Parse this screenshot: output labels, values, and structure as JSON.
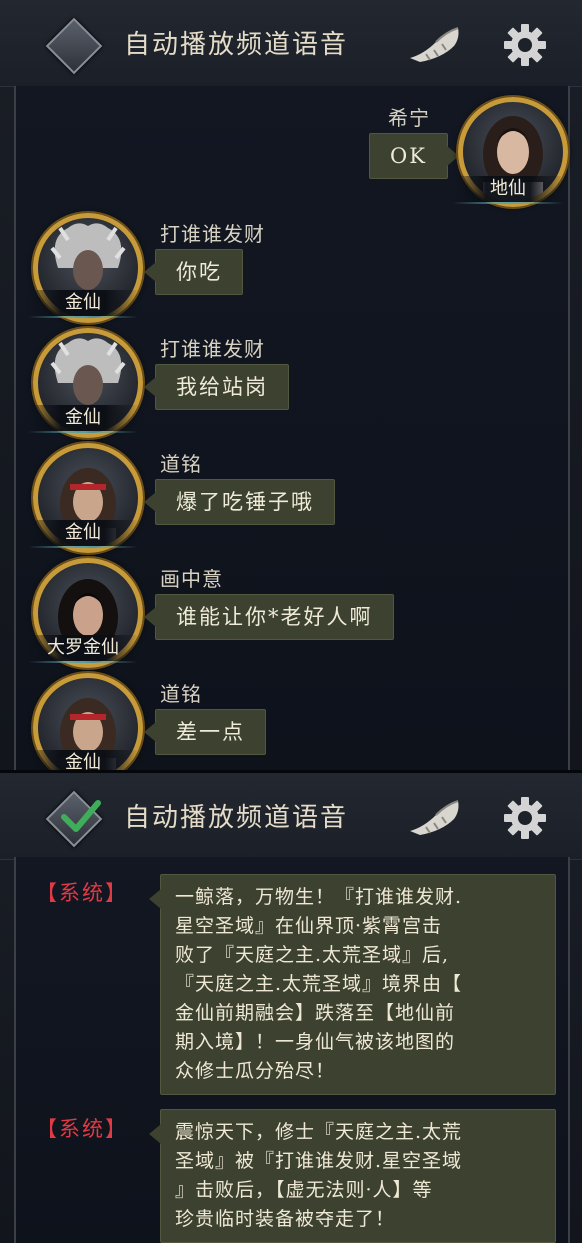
{
  "header": {
    "title": "自动播放频道语音"
  },
  "panel1": {
    "messages": [
      {
        "side": "right",
        "sender": "希宁",
        "rank": "地仙",
        "text": "OK",
        "avatar": "female-portrait"
      },
      {
        "side": "left",
        "sender": "打谁谁发财",
        "rank": "金仙",
        "text": "你吃",
        "avatar": "white-haired-warrior"
      },
      {
        "side": "left",
        "sender": "打谁谁发财",
        "rank": "金仙",
        "text": "我给站岗",
        "avatar": "white-haired-warrior"
      },
      {
        "side": "left",
        "sender": "道铭",
        "rank": "金仙",
        "text": "爆了吃锤子哦",
        "avatar": "headband-warrior"
      },
      {
        "side": "left",
        "sender": "画中意",
        "rank": "大罗金仙",
        "text": "谁能让你*老好人啊",
        "avatar": "dark-haired-woman"
      },
      {
        "side": "left",
        "sender": "道铭",
        "rank": "金仙",
        "text": "差一点",
        "avatar": "headband-warrior"
      }
    ]
  },
  "panel2": {
    "system_messages": [
      {
        "tag": "【系统】",
        "lines": [
          "一鲸落，万物生！『打谁谁发财.",
          "星空圣域』在仙界顶·紫霄宫击",
          "败了『天庭之主.太荒圣域』后,",
          "『天庭之主.太荒圣域』境界由【",
          "金仙前期融会】跌落至【地仙前",
          "期入境】！一身仙气被该地图的",
          "众修士瓜分殆尽！"
        ]
      },
      {
        "tag": "【系统】",
        "lines": [
          "震惊天下，修士『天庭之主.太荒",
          "圣域』被『打谁谁发财.星空圣域",
          "』击败后，【虚无法则·人】等",
          "珍贵临时装备被夺走了！"
        ]
      }
    ]
  },
  "colors": {
    "accent_gold": "#c79a3a",
    "bubble_bg": "#3c4130",
    "system_red": "#e03a44",
    "text_light": "#f0ead8",
    "check_green": "#3fae5a"
  },
  "icons": [
    "diamond-toggle-icon",
    "check-icon",
    "horn-icon",
    "gear-icon"
  ]
}
